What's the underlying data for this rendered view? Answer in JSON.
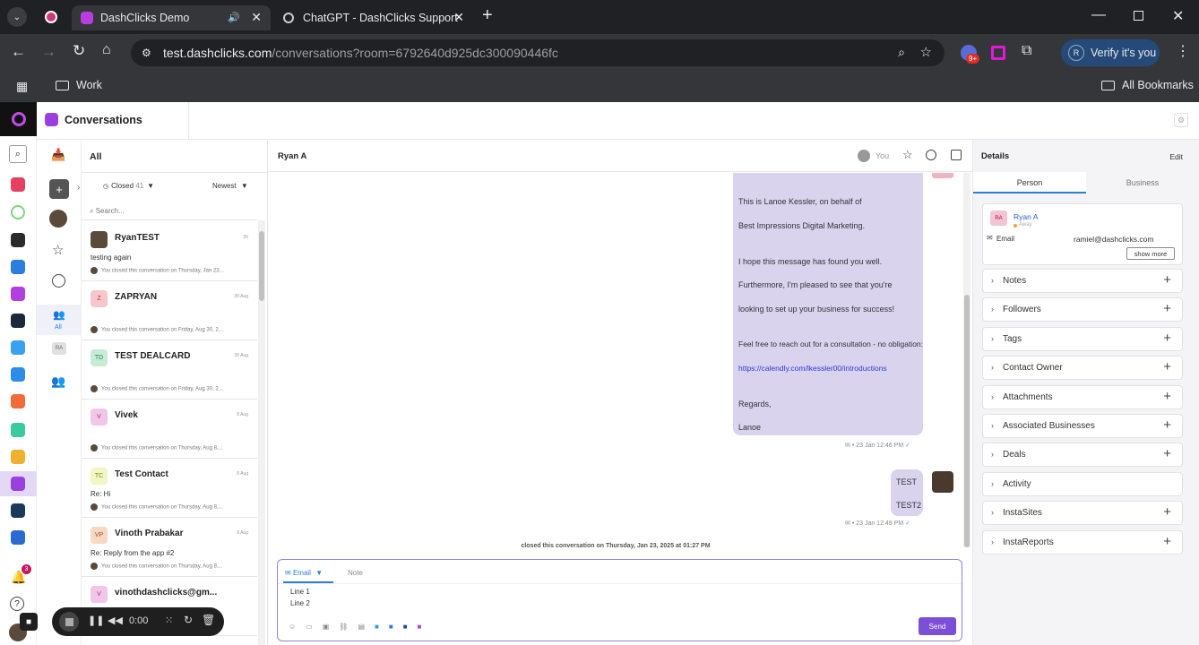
{
  "browser": {
    "tabs": [
      {
        "title": "DashClicks Demo"
      },
      {
        "title": "ChatGPT - DashClicks Support"
      }
    ],
    "url_host": "test.dashclicks.com",
    "url_path": "/conversations?room=6792640d925dc300090446fc",
    "extension_badge": "9+",
    "profile_letter": "R",
    "profile_label": "Verify it's you",
    "bookmark_folder": "Work",
    "all_bookmarks": "All Bookmarks"
  },
  "app": {
    "title": "Conversations",
    "notification_count": "3"
  },
  "iconcol": {
    "all_label": "All",
    "ra_label": "RA"
  },
  "list": {
    "header": "All",
    "filter_label": "Closed",
    "filter_count": "41",
    "sort_label": "Newest",
    "search_placeholder": "Search...",
    "items": [
      {
        "initials": "",
        "name": "RyanTEST",
        "time": "2h",
        "preview": "testing again",
        "status": "You closed this conversation on Thursday, Jan 23..."
      },
      {
        "initials": "Z",
        "name": "ZAPRYAN",
        "time": "30 Aug",
        "preview": "",
        "status": "You closed this conversation on Friday, Aug 30, 2..."
      },
      {
        "initials": "TD",
        "name": "TEST DEALCARD",
        "time": "30 Aug",
        "preview": "",
        "status": "You closed this conversation on Friday, Aug 30, 2..."
      },
      {
        "initials": "V",
        "name": "Vivek",
        "time": "8 Aug",
        "preview": "",
        "status": "You closed this conversation on Thursday, Aug 8,..."
      },
      {
        "initials": "TC",
        "name": "Test Contact",
        "time": "8 Aug",
        "preview": "Re: Hi",
        "status": "You closed this conversation on Thursday, Aug 8,..."
      },
      {
        "initials": "VP",
        "name": "Vinoth Prabakar",
        "time": "8 Aug",
        "preview": "Re: Reply from the app #2",
        "status": "You closed this conversation on Thursday, Aug 8,..."
      },
      {
        "initials": "V",
        "name": "vinothdashclicks@gm...",
        "time": "",
        "preview": "",
        "status": ""
      }
    ]
  },
  "conversation": {
    "contact_name": "Ryan A",
    "assignee": "You",
    "email_lines": [
      "This is Lanoe Kessler, on behalf of",
      "Best Impressions Digital Marketing.",
      "I hope this message has found you well.",
      "Furthermore, I'm pleased to see that you're",
      "looking to set up your business for success!",
      "Feel free to reach out for a consultation - no obligation:",
      "https://calendly.com/lkessler00/introductions",
      "Regards,",
      "Lanoe"
    ],
    "email_meta": "• 23 Jan 12:46 PM",
    "reply_lines": [
      "TEST",
      "TEST2"
    ],
    "reply_meta": "• 23 Jan 12:49 PM",
    "system_note": "closed this conversation on Thursday, Jan 23, 2025 at 01:27 PM",
    "composer": {
      "tab_email": "Email",
      "tab_note": "Note",
      "lines": [
        "Line 1",
        "Line 2"
      ],
      "send_label": "Send"
    }
  },
  "recorder": {
    "time": "0:00"
  },
  "details": {
    "title": "Details",
    "edit_label": "Edit",
    "tabs": [
      "Person",
      "Business"
    ],
    "person": {
      "initials": "RA",
      "name": "Ryan A",
      "presence": "Away",
      "email_label": "Email",
      "email_value": "ramiel@dashclicks.com",
      "show_more": "show more"
    },
    "sections": [
      "Notes",
      "Followers",
      "Tags",
      "Contact Owner",
      "Attachments",
      "Associated Businesses",
      "Deals",
      "Activity",
      "InstaSites",
      "InstaReports"
    ]
  },
  "colors": {
    "accent": "#7b4fd6",
    "bubble": "#d9d3ee",
    "brand_dark": "#111111"
  }
}
